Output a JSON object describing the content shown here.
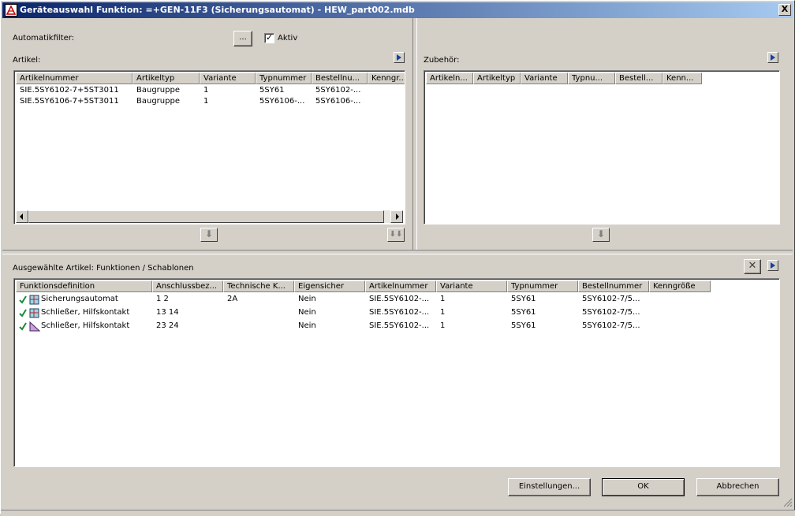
{
  "window": {
    "title": "Geräteauswahl Funktion: =+GEN-11F3 (Sicherungsautomat) - HEW_part002.mdb",
    "close_label": "X"
  },
  "filter": {
    "label": "Automatikfilter:",
    "browse_label": "...",
    "aktiv_label": "Aktiv",
    "aktiv_checked": true
  },
  "artikel": {
    "label": "Artikel:",
    "columns": [
      "Artikelnummer",
      "Artikeltyp",
      "Variante",
      "Typnummer",
      "Bestellnu...",
      "Kenngr..."
    ],
    "rows": [
      [
        "SIE.5SY6102-7+5ST3011",
        "Baugruppe",
        "1",
        "5SY61",
        "5SY6102-...",
        ""
      ],
      [
        "SIE.5SY6106-7+5ST3011",
        "Baugruppe",
        "1",
        "5SY6106-...",
        "5SY6106-...",
        ""
      ]
    ]
  },
  "zubehoer": {
    "label": "Zubehör:",
    "columns": [
      "Artikeln...",
      "Artikeltyp",
      "Variante",
      "Typnu...",
      "Bestell...",
      "Kenn..."
    ]
  },
  "selected": {
    "label": "Ausgewählte Artikel: Funktionen / Schablonen",
    "columns": [
      "Funktionsdefinition",
      "Anschlussbez...",
      "Technische K...",
      "Eigensicher",
      "Artikelnummer",
      "Variante",
      "Typnummer",
      "Bestellnummer",
      "Kenngröße"
    ],
    "rows": [
      [
        "Sicherungsautomat",
        "1 2",
        "2A",
        "Nein",
        "SIE.5SY6102-...",
        "1",
        "5SY61",
        "5SY6102-7/5..."
      ],
      [
        "Schließer, Hilfskontakt",
        "13 14",
        "",
        "Nein",
        "SIE.5SY6102-...",
        "1",
        "5SY61",
        "5SY6102-7/5..."
      ],
      [
        "Schließer, Hilfskontakt",
        "23 24",
        "",
        "Nein",
        "SIE.5SY6102-...",
        "1",
        "5SY61",
        "5SY6102-7/5..."
      ]
    ]
  },
  "buttons": {
    "settings": "Einstellungen...",
    "ok": "OK",
    "cancel": "Abbrechen"
  }
}
